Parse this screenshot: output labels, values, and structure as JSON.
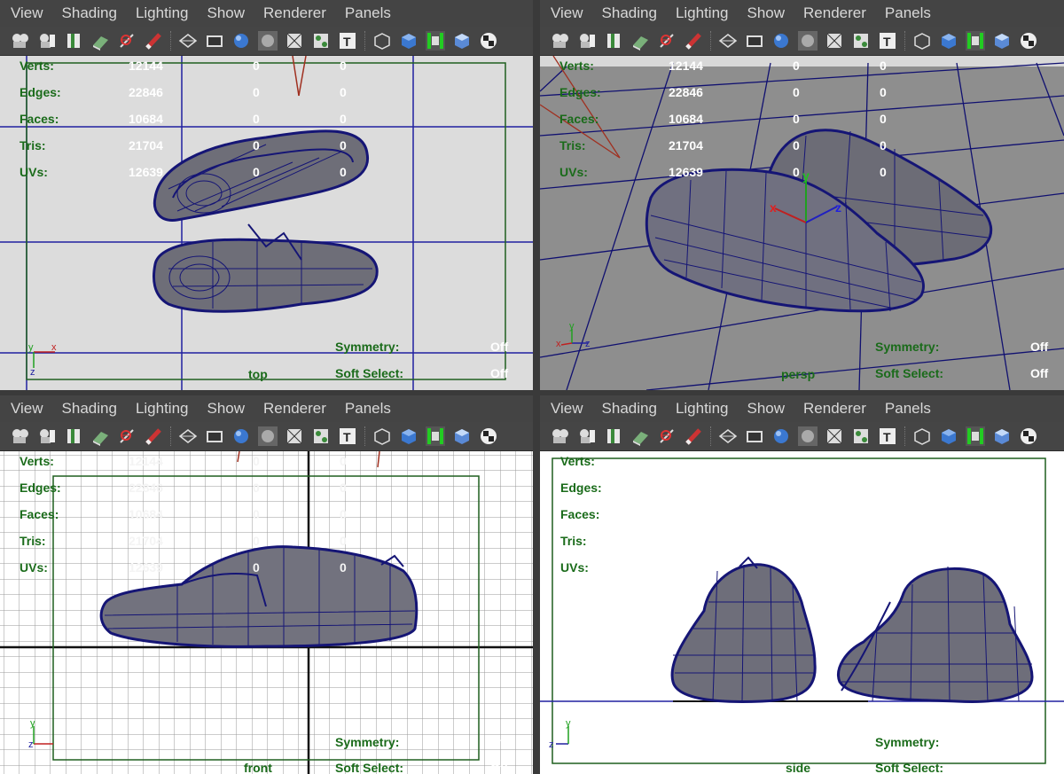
{
  "menus": [
    "View",
    "Shading",
    "Lighting",
    "Show",
    "Renderer",
    "Panels"
  ],
  "toolbar_icons": [
    "camera-select-icon",
    "camera-attributes-icon",
    "bookmark-icon",
    "image-plane-icon",
    "grid-toggle-icon",
    "pencil-icon",
    "wireframe-icon",
    "film-gate-icon",
    "smooth-shade-icon",
    "flat-shade-icon",
    "texture-icon",
    "lights-icon",
    "text-icon",
    "isolate-icon",
    "xray-icon",
    "shadows-icon",
    "ambient-occlusion-icon",
    "checker-icon"
  ],
  "hud": {
    "labels": [
      "Verts:",
      "Edges:",
      "Faces:",
      "Tris:",
      "UVs:"
    ],
    "values": [
      [
        "12144",
        "0",
        "0"
      ],
      [
        "22846",
        "0",
        "0"
      ],
      [
        "10684",
        "0",
        "0"
      ],
      [
        "21704",
        "0",
        "0"
      ],
      [
        "12639",
        "0",
        "0"
      ]
    ],
    "symmetry_label": "Symmetry:",
    "soft_select_label": "Soft Select:",
    "off": "Off"
  },
  "panels": [
    {
      "id": "top",
      "camera": "top"
    },
    {
      "id": "persp",
      "camera": "persp"
    },
    {
      "id": "front",
      "camera": "front"
    },
    {
      "id": "side",
      "camera": "side"
    }
  ],
  "axis_labels": {
    "x": "x",
    "y": "y",
    "z": "z"
  },
  "colors": {
    "mesh": "#151575",
    "hud_label": "#1a6b1a",
    "grid_dark": "#2020a0"
  }
}
